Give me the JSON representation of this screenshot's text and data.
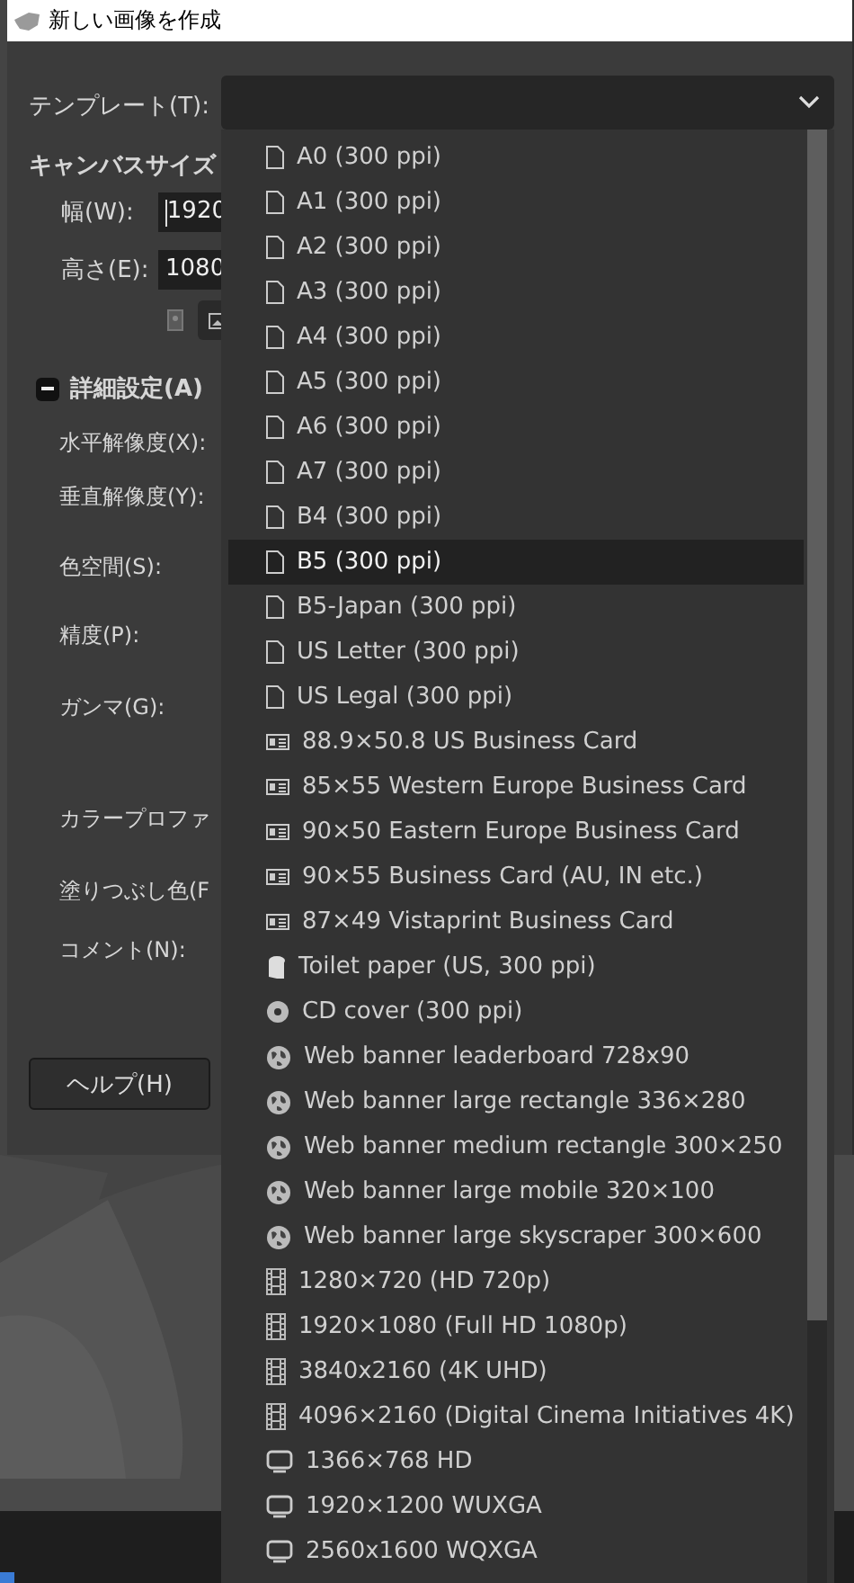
{
  "window": {
    "title": "新しい画像を作成"
  },
  "template": {
    "label": "テンプレート(T):"
  },
  "canvas_size": {
    "heading": "キャンバスサイズ",
    "width_label": "幅(W):",
    "width_value": "1920",
    "height_label": "高さ(E):",
    "height_value": "1080"
  },
  "advanced": {
    "heading": "詳細設定(A)",
    "expanded": true,
    "labels": [
      "水平解像度(X):",
      "垂直解像度(Y):",
      "色空間(S):",
      "精度(P):",
      "ガンマ(G):",
      "カラープロファ",
      "塗りつぶし色(F",
      "コメント(N):"
    ]
  },
  "buttons": [
    "ヘルプ(H)"
  ],
  "dropdown": {
    "items": [
      {
        "label": "A0 (300 ppi)",
        "kind": "page",
        "selected": false
      },
      {
        "label": "A1 (300 ppi)",
        "kind": "page",
        "selected": false
      },
      {
        "label": "A2 (300 ppi)",
        "kind": "page",
        "selected": false
      },
      {
        "label": "A3 (300 ppi)",
        "kind": "page",
        "selected": false
      },
      {
        "label": "A4 (300 ppi)",
        "kind": "page",
        "selected": false
      },
      {
        "label": "A5 (300 ppi)",
        "kind": "page",
        "selected": false
      },
      {
        "label": "A6 (300 ppi)",
        "kind": "page",
        "selected": false
      },
      {
        "label": "A7 (300 ppi)",
        "kind": "page",
        "selected": false
      },
      {
        "label": "B4 (300 ppi)",
        "kind": "page",
        "selected": false
      },
      {
        "label": "B5 (300 ppi)",
        "kind": "page",
        "selected": true
      },
      {
        "label": "B5-Japan (300 ppi)",
        "kind": "page",
        "selected": false
      },
      {
        "label": "US Letter (300 ppi)",
        "kind": "page",
        "selected": false
      },
      {
        "label": "US Legal (300 ppi)",
        "kind": "page",
        "selected": false
      },
      {
        "label": "88.9×50.8 US Business Card",
        "kind": "card",
        "selected": false
      },
      {
        "label": "85×55 Western Europe Business Card",
        "kind": "card",
        "selected": false
      },
      {
        "label": "90×50 Eastern Europe Business Card",
        "kind": "card",
        "selected": false
      },
      {
        "label": "90×55 Business Card (AU, IN etc.)",
        "kind": "card",
        "selected": false
      },
      {
        "label": "87×49 Vistaprint Business Card",
        "kind": "card",
        "selected": false
      },
      {
        "label": "Toilet paper (US, 300 ppi)",
        "kind": "roll",
        "selected": false
      },
      {
        "label": "CD cover (300 ppi)",
        "kind": "disc",
        "selected": false
      },
      {
        "label": "Web banner leaderboard 728x90",
        "kind": "web",
        "selected": false
      },
      {
        "label": "Web banner large rectangle 336×280",
        "kind": "web",
        "selected": false
      },
      {
        "label": "Web banner medium rectangle 300×250",
        "kind": "web",
        "selected": false
      },
      {
        "label": "Web banner large mobile 320×100",
        "kind": "web",
        "selected": false
      },
      {
        "label": "Web banner large skyscraper 300×600",
        "kind": "web",
        "selected": false
      },
      {
        "label": "1280×720 (HD 720p)",
        "kind": "film",
        "selected": false
      },
      {
        "label": "1920×1080 (Full HD 1080p)",
        "kind": "film",
        "selected": false
      },
      {
        "label": "3840x2160 (4K UHD)",
        "kind": "film",
        "selected": false
      },
      {
        "label": "4096×2160 (Digital Cinema Initiatives 4K)",
        "kind": "film",
        "selected": false
      },
      {
        "label": "1366×768 HD",
        "kind": "monitor",
        "selected": false
      },
      {
        "label": "1920×1200 WUXGA",
        "kind": "monitor",
        "selected": false
      },
      {
        "label": "2560x1600 WQXGA",
        "kind": "monitor",
        "selected": false
      }
    ]
  }
}
